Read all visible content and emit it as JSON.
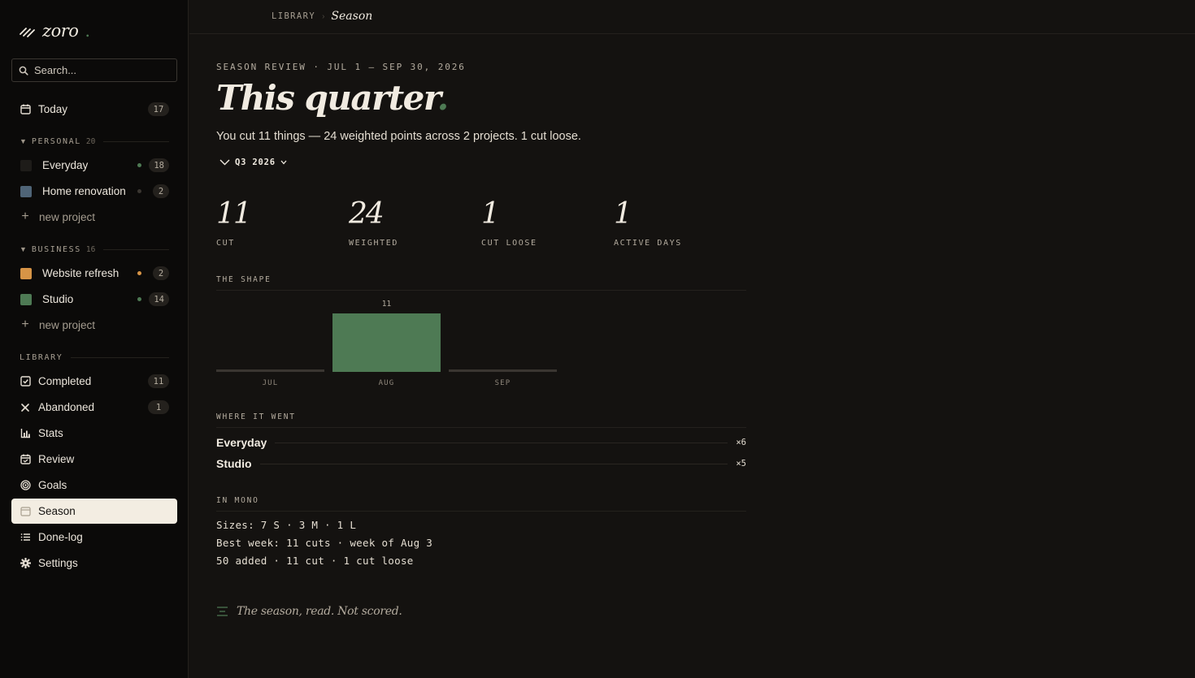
{
  "app": {
    "name": "zoro",
    "brand_accent": "#4e7a54"
  },
  "search": {
    "placeholder": "Search..."
  },
  "today": {
    "label": "Today",
    "count": "17"
  },
  "personal": {
    "label": "PERSONAL",
    "count": "20",
    "projects": [
      {
        "label": "Everyday",
        "count": "18",
        "swatch": "#1e1c19",
        "dot": "#4e7a54"
      },
      {
        "label": "Home renovation",
        "count": "2",
        "swatch": "#4f6477",
        "dot": "#3a3631"
      }
    ],
    "new_label": "new project"
  },
  "business": {
    "label": "BUSINESS",
    "count": "16",
    "projects": [
      {
        "label": "Website refresh",
        "count": "2",
        "swatch": "#d69446",
        "dot": "#d69446"
      },
      {
        "label": "Studio",
        "count": "14",
        "swatch": "#4e7a54",
        "dot": "#4e7a54"
      }
    ],
    "new_label": "new project"
  },
  "library": {
    "label": "LIBRARY",
    "items": [
      {
        "label": "Completed",
        "count": "11",
        "icon": "check-square-icon"
      },
      {
        "label": "Abandoned",
        "count": "1",
        "icon": "x-icon"
      },
      {
        "label": "Stats",
        "icon": "bar-chart-icon"
      },
      {
        "label": "Review",
        "icon": "calendar-review-icon"
      },
      {
        "label": "Goals",
        "icon": "target-icon"
      },
      {
        "label": "Season",
        "icon": "calendar-icon",
        "active": true
      },
      {
        "label": "Done-log",
        "icon": "list-icon"
      },
      {
        "label": "Settings",
        "icon": "gear-icon"
      }
    ]
  },
  "breadcrumb": {
    "section": "LIBRARY",
    "separator": "›",
    "current": "Season"
  },
  "page": {
    "eyebrow": "SEASON REVIEW · JUL 1 – SEP 30, 2026",
    "title": "This quarter",
    "title_accent": ".",
    "summary": "You cut 11 things — 24 weighted points across 2 projects. 1 cut loose.",
    "period_label": "Q3 2026"
  },
  "stats": [
    {
      "value": "11",
      "caption": "CUT"
    },
    {
      "value": "24",
      "caption": "WEIGHTED"
    },
    {
      "value": "1",
      "caption": "CUT LOOSE"
    },
    {
      "value": "1",
      "caption": "ACTIVE DAYS"
    }
  ],
  "shape": {
    "label": "THE SHAPE"
  },
  "chart_data": {
    "type": "bar",
    "categories": [
      "JUL",
      "AUG",
      "SEP"
    ],
    "values": [
      0,
      11,
      0
    ],
    "data_labels": [
      "",
      "11",
      ""
    ],
    "bar_color": "#4e7a54",
    "empty_color": "#3a3631",
    "ylim": [
      0,
      11
    ]
  },
  "where": {
    "label": "WHERE IT WENT",
    "rows": [
      {
        "name": "Everyday",
        "mult": "×6"
      },
      {
        "name": "Studio",
        "mult": "×5"
      }
    ]
  },
  "mono": {
    "label": "IN MONO",
    "lines": [
      "Sizes: 7 S · 3 M · 1 L",
      "Best week: 11 cuts · week of Aug 3",
      "50 added · 11 cut · 1 cut loose"
    ]
  },
  "footer": {
    "text": "The season, read. Not scored."
  }
}
